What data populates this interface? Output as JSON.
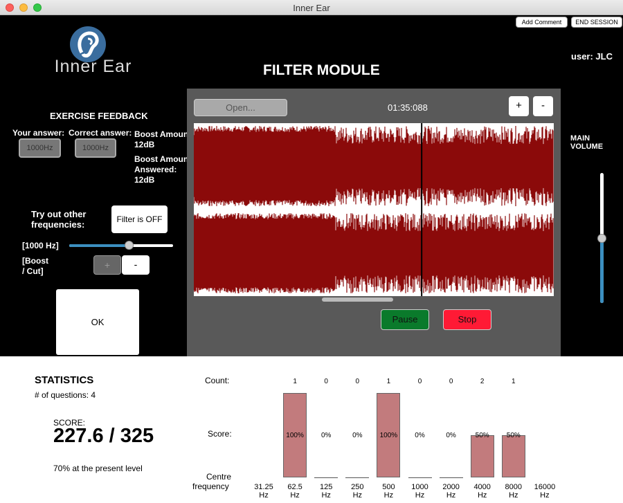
{
  "window": {
    "title": "Inner Ear"
  },
  "header": {
    "add_comment": "Add Comment",
    "end_session": "END SESSION",
    "logo_text": "Inner Ear",
    "module_title": "FILTER MODULE",
    "user": "user: JLC"
  },
  "feedback": {
    "title": "EXERCISE FEEDBACK",
    "your_answer_label": "Your answer:",
    "your_answer_value": "1000Hz",
    "correct_answer_label": "Correct answer:",
    "correct_answer_value": "1000Hz",
    "boost_amount_label": "Boost Amount:",
    "boost_amount_value": "12dB",
    "boost_answered_label_1": "Boost Amount",
    "boost_answered_label_2": "Answered:",
    "boost_answered_value": "12dB",
    "try_label_1": "Try out other",
    "try_label_2": "frequencies:",
    "filter_button": "Filter is OFF",
    "freq_label": "[1000 Hz]",
    "freq_slider_fraction": 0.57,
    "boost_label_1": "[Boost",
    "boost_label_2": "/ Cut]",
    "plus": "+",
    "minus": "-",
    "ok": "OK"
  },
  "player": {
    "open_button": "Open...",
    "time": "01:35:088",
    "zoom_in": "+",
    "zoom_out": "-",
    "playhead_fraction": 0.633,
    "pause": "Pause",
    "stop": "Stop"
  },
  "volume": {
    "label": "MAIN VOLUME",
    "level": 0.5
  },
  "statistics": {
    "title": "STATISTICS",
    "questions": "# of questions: 4",
    "score_label": "SCORE:",
    "score": "227.6 / 325",
    "level_text": "70% at the present level",
    "count_label": "Count:",
    "score_row_label": "Score:",
    "centre_label_1": "Centre",
    "centre_label_2": "frequency",
    "bands": [
      {
        "freq": "31.25",
        "unit": "Hz"
      },
      {
        "freq": "62.5",
        "unit": "Hz",
        "count": "1",
        "score": "100%",
        "fraction": 1.0
      },
      {
        "freq": "125",
        "unit": "Hz",
        "count": "0",
        "score": "0%",
        "fraction": 0
      },
      {
        "freq": "250",
        "unit": "Hz",
        "count": "0",
        "score": "0%",
        "fraction": 0
      },
      {
        "freq": "500",
        "unit": "Hz",
        "count": "1",
        "score": "100%",
        "fraction": 1.0
      },
      {
        "freq": "1000",
        "unit": "Hz",
        "count": "0",
        "score": "0%",
        "fraction": 0
      },
      {
        "freq": "2000",
        "unit": "Hz",
        "count": "0",
        "score": "0%",
        "fraction": 0
      },
      {
        "freq": "4000",
        "unit": "Hz",
        "count": "2",
        "score": "50%",
        "fraction": 0.5
      },
      {
        "freq": "8000",
        "unit": "Hz",
        "count": "1",
        "score": "50%",
        "fraction": 0.5
      },
      {
        "freq": "16000",
        "unit": "Hz"
      }
    ]
  },
  "colors": {
    "waveform": "#8b0a0a",
    "accent": "#3c8fc0",
    "bar": "#c27b7d",
    "pause": "#0a7a2b",
    "stop": "#ff1a35"
  }
}
